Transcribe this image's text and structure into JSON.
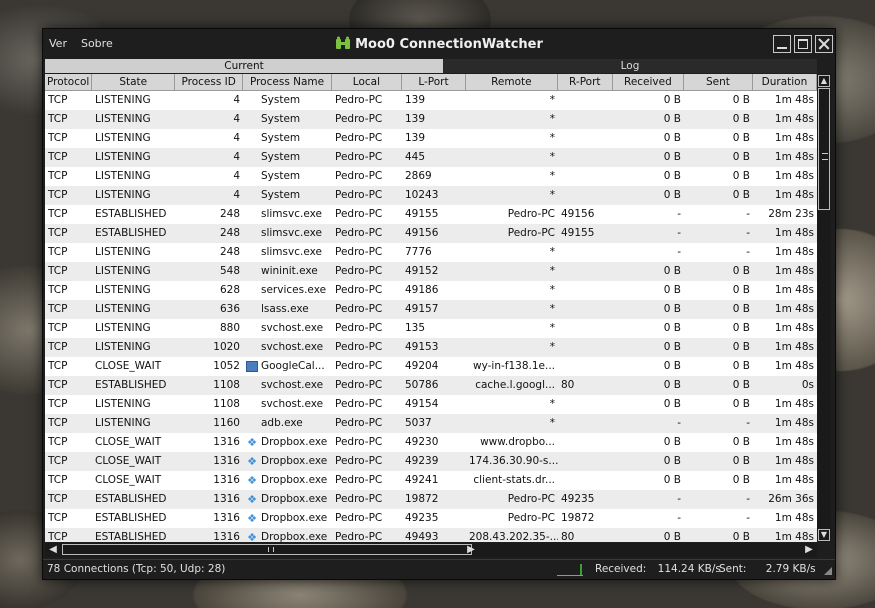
{
  "window": {
    "title": "Moo0 ConnectionWatcher",
    "menu": [
      "Ver",
      "Sobre"
    ]
  },
  "tabs": [
    "Current",
    "Log"
  ],
  "columns": [
    "Protocol",
    "State",
    "Process ID",
    "Process Name",
    "Local",
    "L-Port",
    "Remote",
    "R-Port",
    "Received",
    "Sent",
    "Duration"
  ],
  "rows": [
    [
      "TCP",
      "LISTENING",
      "4",
      "System",
      "Pedro-PC",
      "139",
      "*",
      "",
      "0 B",
      "0 B",
      "1m 48s",
      "none"
    ],
    [
      "TCP",
      "LISTENING",
      "4",
      "System",
      "Pedro-PC",
      "139",
      "*",
      "",
      "0 B",
      "0 B",
      "1m 48s",
      "none"
    ],
    [
      "TCP",
      "LISTENING",
      "4",
      "System",
      "Pedro-PC",
      "139",
      "*",
      "",
      "0 B",
      "0 B",
      "1m 48s",
      "none"
    ],
    [
      "TCP",
      "LISTENING",
      "4",
      "System",
      "Pedro-PC",
      "445",
      "*",
      "",
      "0 B",
      "0 B",
      "1m 48s",
      "none"
    ],
    [
      "TCP",
      "LISTENING",
      "4",
      "System",
      "Pedro-PC",
      "2869",
      "*",
      "",
      "0 B",
      "0 B",
      "1m 48s",
      "none"
    ],
    [
      "TCP",
      "LISTENING",
      "4",
      "System",
      "Pedro-PC",
      "10243",
      "*",
      "",
      "0 B",
      "0 B",
      "1m 48s",
      "none"
    ],
    [
      "TCP",
      "ESTABLISHED",
      "248",
      "slimsvc.exe",
      "Pedro-PC",
      "49155",
      "Pedro-PC",
      "49156",
      "-",
      "-",
      "28m 23s",
      "none"
    ],
    [
      "TCP",
      "ESTABLISHED",
      "248",
      "slimsvc.exe",
      "Pedro-PC",
      "49156",
      "Pedro-PC",
      "49155",
      "-",
      "-",
      "1m 48s",
      "none"
    ],
    [
      "TCP",
      "LISTENING",
      "248",
      "slimsvc.exe",
      "Pedro-PC",
      "7776",
      "*",
      "",
      "-",
      "-",
      "1m 48s",
      "none"
    ],
    [
      "TCP",
      "LISTENING",
      "548",
      "wininit.exe",
      "Pedro-PC",
      "49152",
      "*",
      "",
      "0 B",
      "0 B",
      "1m 48s",
      "none"
    ],
    [
      "TCP",
      "LISTENING",
      "628",
      "services.exe",
      "Pedro-PC",
      "49186",
      "*",
      "",
      "0 B",
      "0 B",
      "1m 48s",
      "none"
    ],
    [
      "TCP",
      "LISTENING",
      "636",
      "lsass.exe",
      "Pedro-PC",
      "49157",
      "*",
      "",
      "0 B",
      "0 B",
      "1m 48s",
      "none"
    ],
    [
      "TCP",
      "LISTENING",
      "880",
      "svchost.exe",
      "Pedro-PC",
      "135",
      "*",
      "",
      "0 B",
      "0 B",
      "1m 48s",
      "none"
    ],
    [
      "TCP",
      "LISTENING",
      "1020",
      "svchost.exe",
      "Pedro-PC",
      "49153",
      "*",
      "",
      "0 B",
      "0 B",
      "1m 48s",
      "none"
    ],
    [
      "TCP",
      "CLOSE_WAIT",
      "1052",
      "GoogleCal...",
      "Pedro-PC",
      "49204",
      "wy-in-f138.1e...",
      "",
      "0 B",
      "0 B",
      "1m 48s",
      "calendar-icon"
    ],
    [
      "TCP",
      "ESTABLISHED",
      "1108",
      "svchost.exe",
      "Pedro-PC",
      "50786",
      "cache.l.googl...",
      "80",
      "0 B",
      "0 B",
      "0s",
      "none"
    ],
    [
      "TCP",
      "LISTENING",
      "1108",
      "svchost.exe",
      "Pedro-PC",
      "49154",
      "*",
      "",
      "0 B",
      "0 B",
      "1m 48s",
      "none"
    ],
    [
      "TCP",
      "LISTENING",
      "1160",
      "adb.exe",
      "Pedro-PC",
      "5037",
      "*",
      "",
      "-",
      "-",
      "1m 48s",
      "none"
    ],
    [
      "TCP",
      "CLOSE_WAIT",
      "1316",
      "Dropbox.exe",
      "Pedro-PC",
      "49230",
      "www.dropbo...",
      "",
      "0 B",
      "0 B",
      "1m 48s",
      "dropbox-icon"
    ],
    [
      "TCP",
      "CLOSE_WAIT",
      "1316",
      "Dropbox.exe",
      "Pedro-PC",
      "49239",
      "174.36.30.90-s...",
      "",
      "0 B",
      "0 B",
      "1m 48s",
      "dropbox-icon"
    ],
    [
      "TCP",
      "CLOSE_WAIT",
      "1316",
      "Dropbox.exe",
      "Pedro-PC",
      "49241",
      "client-stats.dr...",
      "",
      "0 B",
      "0 B",
      "1m 48s",
      "dropbox-icon"
    ],
    [
      "TCP",
      "ESTABLISHED",
      "1316",
      "Dropbox.exe",
      "Pedro-PC",
      "19872",
      "Pedro-PC",
      "49235",
      "-",
      "-",
      "26m 36s",
      "dropbox-icon"
    ],
    [
      "TCP",
      "ESTABLISHED",
      "1316",
      "Dropbox.exe",
      "Pedro-PC",
      "49235",
      "Pedro-PC",
      "19872",
      "-",
      "-",
      "1m 48s",
      "dropbox-icon"
    ],
    [
      "TCP",
      "ESTABLISHED",
      "1316",
      "Dropbox.exe",
      "Pedro-PC",
      "49493",
      "208.43.202.35-...",
      "80",
      "0 B",
      "0 B",
      "1m 48s",
      "dropbox-icon"
    ]
  ],
  "status": {
    "connections": "78 Connections (Tcp: 50, Udp: 28)",
    "received_label": "Received:",
    "received_value": "114.24 KB/s",
    "sent_label": "Sent:",
    "sent_value": "2.79 KB/s"
  },
  "colors": {
    "accent_logo": "#7cc242",
    "sparkline": "#3fcf3f"
  }
}
